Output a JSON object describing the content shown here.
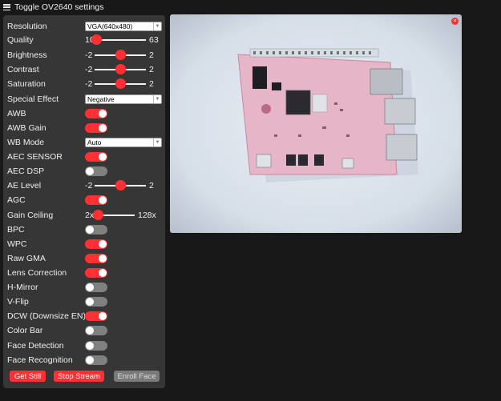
{
  "header": {
    "title": "Toggle OV2640 settings",
    "menu_icon": "hamburger-icon"
  },
  "colors": {
    "accent": "#ff3034",
    "panel": "#363636",
    "background": "#181818",
    "toggle_off": "#808080"
  },
  "settings": {
    "resolution": {
      "label": "Resolution",
      "value": "VGA(640x480)"
    },
    "quality": {
      "label": "Quality",
      "min": "10",
      "max": "63",
      "value": 10
    },
    "brightness": {
      "label": "Brightness",
      "min": "-2",
      "max": "2",
      "value": 0
    },
    "contrast": {
      "label": "Contrast",
      "min": "-2",
      "max": "2",
      "value": 0
    },
    "saturation": {
      "label": "Saturation",
      "min": "-2",
      "max": "2",
      "value": 0
    },
    "special_effect": {
      "label": "Special Effect",
      "value": "Negative"
    },
    "awb": {
      "label": "AWB",
      "on": true
    },
    "awb_gain": {
      "label": "AWB Gain",
      "on": true
    },
    "wb_mode": {
      "label": "WB Mode",
      "value": "Auto"
    },
    "aec_sensor": {
      "label": "AEC SENSOR",
      "on": true
    },
    "aec_dsp": {
      "label": "AEC DSP",
      "on": false
    },
    "ae_level": {
      "label": "AE Level",
      "min": "-2",
      "max": "2",
      "value": 0
    },
    "agc": {
      "label": "AGC",
      "on": true
    },
    "gain_ceiling": {
      "label": "Gain Ceiling",
      "min": "2x",
      "max": "128x",
      "value": 0
    },
    "bpc": {
      "label": "BPC",
      "on": false
    },
    "wpc": {
      "label": "WPC",
      "on": true
    },
    "raw_gma": {
      "label": "Raw GMA",
      "on": true
    },
    "lens_correction": {
      "label": "Lens Correction",
      "on": true
    },
    "h_mirror": {
      "label": "H-Mirror",
      "on": false
    },
    "v_flip": {
      "label": "V-Flip",
      "on": false
    },
    "dcw": {
      "label": "DCW (Downsize EN)",
      "on": true
    },
    "color_bar": {
      "label": "Color Bar",
      "on": false
    },
    "face_detection": {
      "label": "Face Detection",
      "on": false
    },
    "face_recognition": {
      "label": "Face Recognition",
      "on": false
    }
  },
  "buttons": {
    "get_still": "Get Still",
    "stop_stream": "Stop Stream",
    "enroll_face": "Enroll Face"
  },
  "stream": {
    "close_label": "×",
    "image_description": "camera view of a circuit board"
  }
}
